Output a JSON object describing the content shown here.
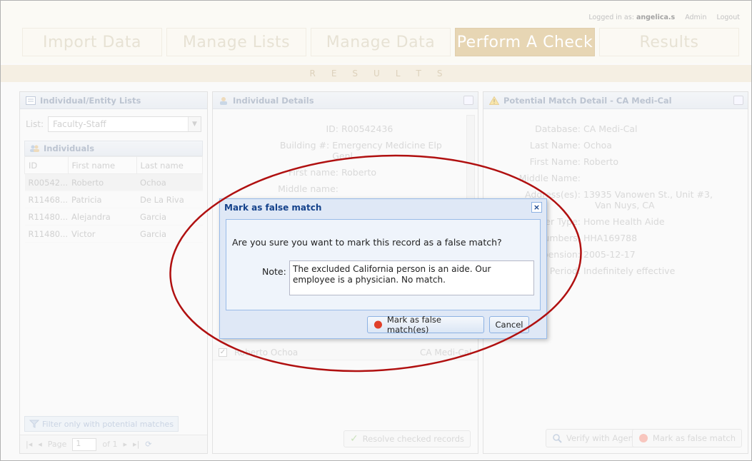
{
  "header": {
    "logged_in_prefix": "Logged in as:",
    "username": "angelica.s",
    "admin_link": "Admin",
    "logout_link": "Logout"
  },
  "nav": {
    "tabs": [
      "Import Data",
      "Manage Lists",
      "Manage Data",
      "Perform A Check",
      "Results"
    ],
    "active": "Perform A Check"
  },
  "banner_letters": [
    "R",
    "E",
    "S",
    "U",
    "L",
    "T",
    "S"
  ],
  "lists_panel": {
    "title": "Individual/Entity Lists",
    "list_label": "List:",
    "list_value": "Faculty-Staff",
    "individuals_title": "Individuals",
    "columns": [
      "ID",
      "First name",
      "Last name"
    ],
    "rows": [
      [
        "R00542...",
        "Roberto",
        "Ochoa"
      ],
      [
        "R11468...",
        "Patricia",
        "De La Riva"
      ],
      [
        "R11480...",
        "Alejandra",
        "Garcia"
      ],
      [
        "R11480...",
        "Victor",
        "Garcia"
      ]
    ],
    "filter_label": "Filter only with potential matches",
    "pager": {
      "page_label": "Page",
      "page_value": "1",
      "of_label": "of 1"
    }
  },
  "details_panel": {
    "title": "Individual Details",
    "fields": [
      {
        "label": "ID:",
        "value": "R00542436"
      },
      {
        "label": "Building #:",
        "value": "Emergency Medicine Elp Genl"
      },
      {
        "label": "First name:",
        "value": "Roberto"
      },
      {
        "label": "Middle name:",
        "value": ""
      }
    ],
    "check_row": {
      "name": "Roberto Ochoa",
      "database": "CA Medi-Cal",
      "checked": "✓"
    },
    "resolve_label": "Resolve checked records"
  },
  "match_panel": {
    "title": "Potential Match Detail - CA Medi-Cal",
    "fields": [
      {
        "label": "Database:",
        "value": "CA Medi-Cal"
      },
      {
        "label": "Last Name:",
        "value": "Ochoa"
      },
      {
        "label": "First Name:",
        "value": "Roberto"
      },
      {
        "label": "Middle Name:",
        "value": ""
      },
      {
        "label": "Address(es):",
        "value": "13935 Vanowen St., Unit #3,",
        "value2": "Van Nuys, CA"
      },
      {
        "label": "Provider Type:",
        "value": "Home Health Aide"
      },
      {
        "label": "License Numbers:",
        "value": "HHA169788"
      },
      {
        "label": "Date of Suspension:",
        "value": "2005-12-17"
      },
      {
        "label": "Suspension Period:",
        "value": "Indefinitely effective"
      }
    ],
    "verify_label": "Verify with Agency",
    "false_match_label": "Mark as false match"
  },
  "dialog": {
    "title": "Mark as false match",
    "close": "×",
    "question": "Are you sure you want to mark this record as a false match?",
    "note_label": "Note:",
    "note_value": "The excluded California person is an aide. Our employee is a physician. No match.",
    "confirm_label": "Mark as false match(es)",
    "cancel_label": "Cancel"
  },
  "colors": {
    "nav_active": "#c9a45a",
    "annotation_ellipse": "#b01010",
    "dialog_title": "#15428b"
  }
}
